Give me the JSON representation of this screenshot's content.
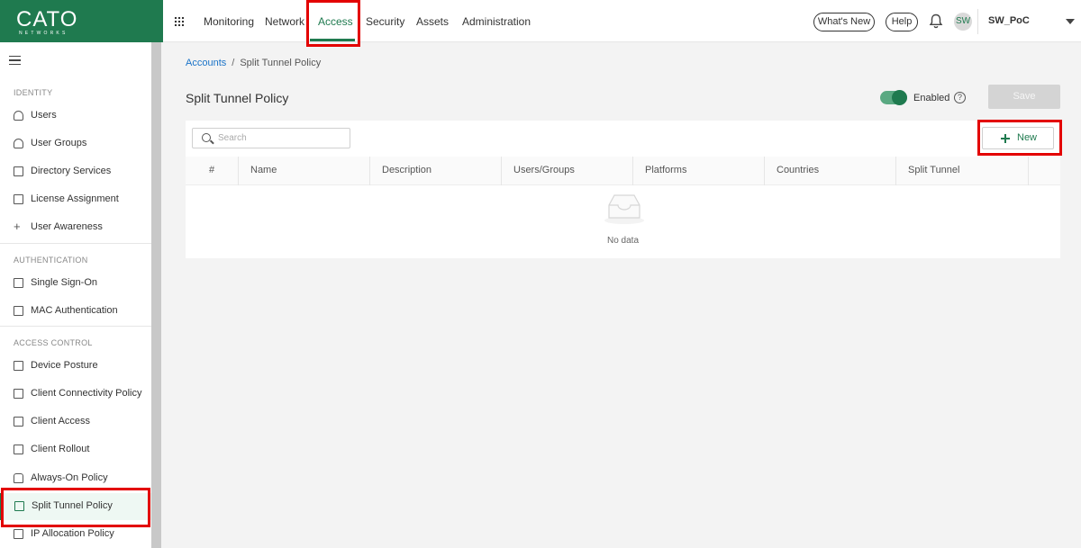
{
  "logo": {
    "word": "CATO",
    "sub": "NETWORKS"
  },
  "nav": {
    "items": [
      "Monitoring",
      "Network",
      "Access",
      "Security",
      "Assets",
      "Administration"
    ],
    "active": "Access"
  },
  "header": {
    "whats_new": "What's New",
    "help": "Help",
    "avatar_initials": "SW",
    "account_name": "SW_PoC"
  },
  "sidebar": {
    "sections": [
      {
        "label": "IDENTITY",
        "items": [
          "Users",
          "User Groups",
          "Directory Services",
          "License Assignment",
          "User Awareness"
        ]
      },
      {
        "label": "AUTHENTICATION",
        "items": [
          "Single Sign-On",
          "MAC Authentication"
        ]
      },
      {
        "label": "ACCESS CONTROL",
        "items": [
          "Device Posture",
          "Client Connectivity Policy",
          "Client Access",
          "Client Rollout",
          "Always-On Policy",
          "Split Tunnel Policy",
          "IP Allocation Policy"
        ]
      }
    ],
    "active_item": "Split Tunnel Policy"
  },
  "breadcrumb": {
    "root": "Accounts",
    "separator": "/",
    "current": "Split Tunnel Policy"
  },
  "page": {
    "title": "Split Tunnel Policy",
    "toggle_label": "Enabled",
    "toggle_on": true,
    "save_label": "Save"
  },
  "toolbar": {
    "search_placeholder": "Search",
    "new_label": "New"
  },
  "table": {
    "columns": [
      "#",
      "Name",
      "Description",
      "Users/Groups",
      "Platforms",
      "Countries",
      "Split Tunnel"
    ],
    "rows": [],
    "empty_text": "No data"
  },
  "colors": {
    "brand": "#1f7a4f",
    "highlight": "#e30000",
    "link": "#1a73c8"
  }
}
